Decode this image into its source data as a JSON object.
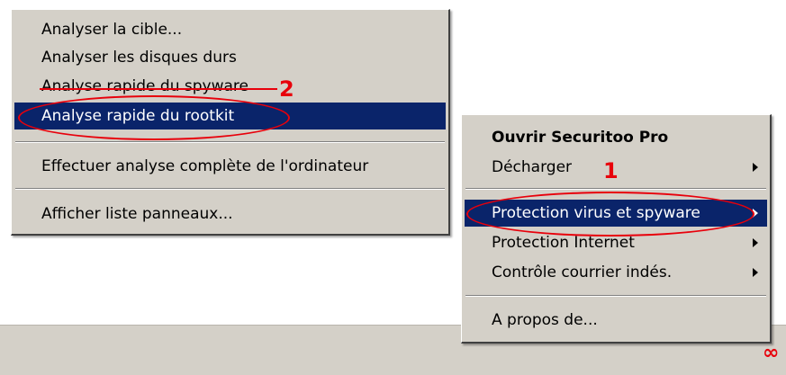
{
  "analysis_menu": {
    "items": [
      {
        "label": "Analyser la cible..."
      },
      {
        "label": "Analyser les disques durs"
      },
      {
        "label": "Analyse rapide du spyware"
      },
      {
        "label": "Analyse rapide du rootkit"
      },
      {
        "label": "Effectuer analyse complète de l'ordinateur"
      },
      {
        "label": "Afficher liste panneaux..."
      }
    ]
  },
  "tray_menu": {
    "items": [
      {
        "label": "Ouvrir Securitoo Pro"
      },
      {
        "label": "Décharger"
      },
      {
        "label": "Protection virus et spyware"
      },
      {
        "label": "Protection Internet"
      },
      {
        "label": "Contrôle courrier indés."
      },
      {
        "label": "A propos de..."
      }
    ]
  },
  "annotations": {
    "step1": "1",
    "step2": "2"
  },
  "taskbar": {
    "tray_icon": "infinity-icon"
  },
  "colors": {
    "highlight": "#0a246a",
    "menu_bg": "#d4d0c8",
    "annotation": "#e8000b"
  }
}
